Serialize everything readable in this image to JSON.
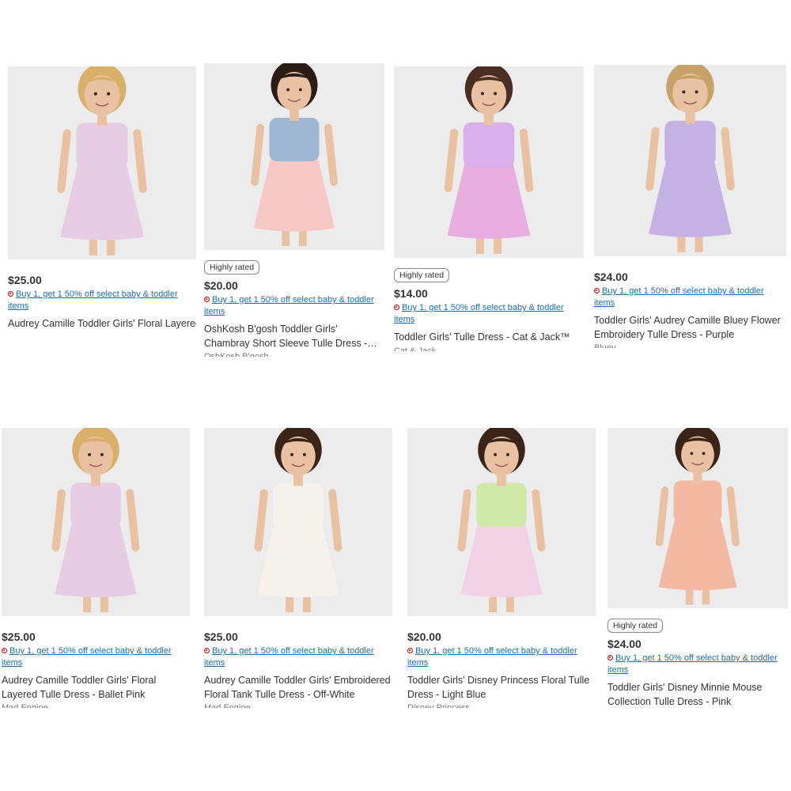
{
  "products": [
    {
      "price": "$25.00",
      "badge": "",
      "promo": "Buy 1, get 1 50% off select baby & toddler items",
      "title": "Audrey Camille Toddler Girls' Floral Layered Tulle Dress - Ballet Pink",
      "brand": "",
      "dress_color": "#e6cde3",
      "top_color": "#e6cde3",
      "hair_color": "#d9b06a",
      "image": "girl-lavender-ruffle-dress"
    },
    {
      "price": "$20.00",
      "badge": "Highly rated",
      "promo": "Buy 1, get 1 50% off select baby & toddler items",
      "title": "OshKosh B'gosh Toddler Girls' Chambray Short Sleeve Tulle Dress - Light Pink/Blue...",
      "brand": "OshKosh B'gosh",
      "dress_color": "#f6c9c6",
      "top_color": "#9fb7d3",
      "hair_color": "#2b1d16",
      "image": "girl-chambray-tulle-dress"
    },
    {
      "price": "$14.00",
      "badge": "Highly rated",
      "promo": "Buy 1, get 1 50% off select baby & toddler items",
      "title": "Toddler Girls' Tulle Dress - Cat & Jack™",
      "brand": "Cat & Jack",
      "dress_color": "#e8aee0",
      "top_color": "#dab0ec",
      "hair_color": "#4a2e22",
      "image": "girl-lilac-tulle-dress"
    },
    {
      "price": "$24.00",
      "badge": "",
      "promo": "Buy 1, get 1 50% off select baby & toddler items",
      "title": "Toddler Girls' Audrey Camille Bluey Flower Embroidery Tulle Dress - Purple",
      "brand": "Bluey",
      "dress_color": "#c5b2e4",
      "top_color": "#c5b2e4",
      "hair_color": "#c9a26a",
      "image": "girl-purple-bluey-dress"
    },
    {
      "price": "$25.00",
      "badge": "",
      "promo": "Buy 1, get 1 50% off select baby & toddler items",
      "title": "Audrey Camille Toddler Girls' Floral Layered Tulle Dress - Ballet Pink",
      "brand": "Mad Engine",
      "dress_color": "#e6cde3",
      "top_color": "#e6cde3",
      "hair_color": "#d9b06a",
      "image": "girl-lavender-ruffle-dress"
    },
    {
      "price": "$25.00",
      "badge": "",
      "promo": "Buy 1, get 1 50% off select baby & toddler items",
      "title": "Audrey Camille Toddler Girls' Embroidered Floral Tank Tulle Dress - Off-White",
      "brand": "Mad Engine",
      "dress_color": "#f5f2ee",
      "top_color": "#f5f2ee",
      "hair_color": "#3a2418",
      "image": "girl-white-floral-dress"
    },
    {
      "price": "$20.00",
      "badge": "",
      "promo": "Buy 1, get 1 50% off select baby & toddler items",
      "title": "Toddler Girls' Disney Princess Floral Tulle Dress - Light Blue",
      "brand": "Disney Princess",
      "dress_color": "#f2d3e6",
      "top_color": "#cfe9a8",
      "hair_color": "#3a2418",
      "image": "girl-floral-princess-dress"
    },
    {
      "price": "$24.00",
      "badge": "Highly rated",
      "promo": "Buy 1, get 1 50% off select baby & toddler items",
      "title": "Toddler Girls' Disney Minnie Mouse Collection Tulle Dress - Pink",
      "brand": "",
      "dress_color": "#f4b9a3",
      "top_color": "#f4b9a3",
      "hair_color": "#3a2418",
      "image": "girl-peach-ruffle-dress"
    }
  ]
}
